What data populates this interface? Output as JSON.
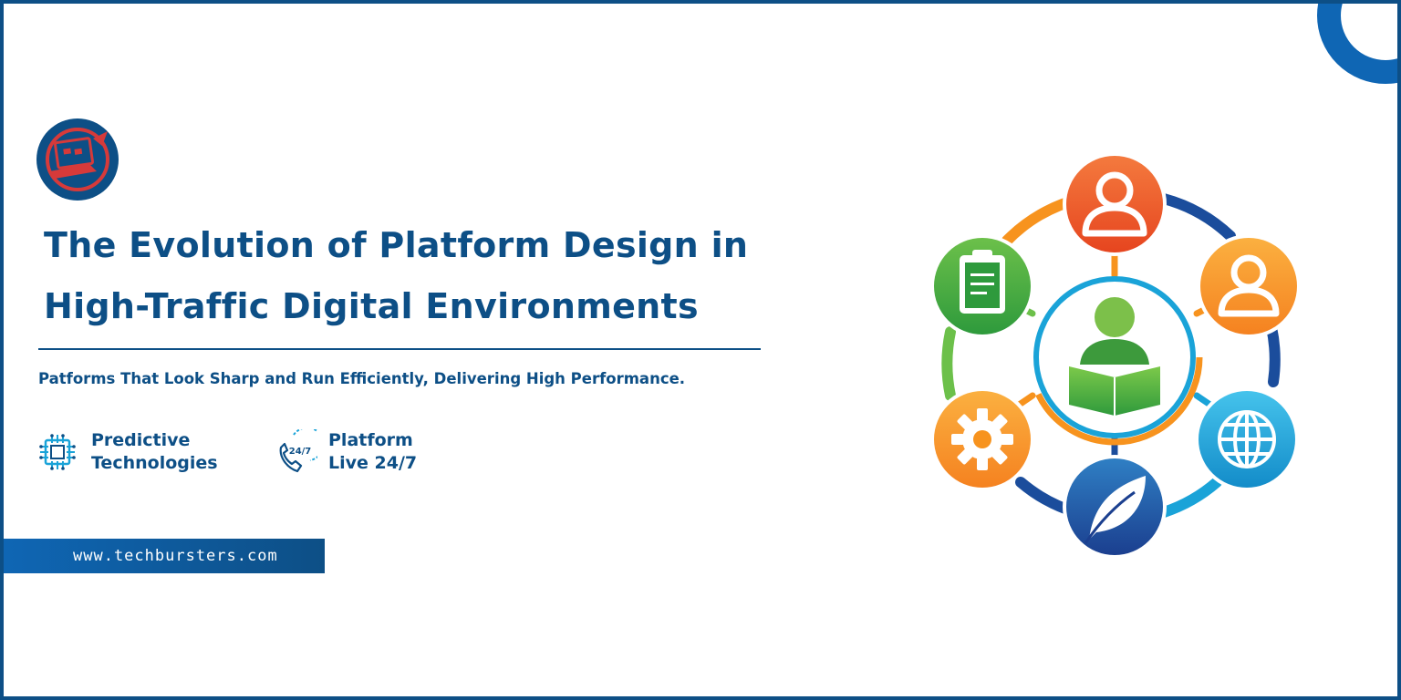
{
  "banner": {
    "title_line1": "The Evolution of Platform Design in",
    "title_line2": "High-Traffic Digital Environments",
    "subtitle": "Patforms That Look Sharp and Run Efficiently, Delivering High Performance.",
    "features": [
      {
        "icon": "chip-icon",
        "line1": "Predictive",
        "line2": "Technologies"
      },
      {
        "icon": "phone-24-7-icon",
        "line1": "Platform",
        "line2": "Live 24/7"
      }
    ],
    "website": "www.techbursters.com",
    "logo_icon": "laptop-rocket-logo",
    "badge_24_7": "24/7",
    "colors": {
      "brand_dark": "#0d4f86",
      "brand_blue": "#0f66b4",
      "logo_red": "#d63a3a"
    }
  },
  "network_illustration": {
    "center_icon": "reader-book-icon",
    "nodes": [
      {
        "icon": "user-icon",
        "color": "#f05a2a"
      },
      {
        "icon": "user-icon",
        "color": "#f7931e"
      },
      {
        "icon": "globe-icon",
        "color": "#1aa3d8"
      },
      {
        "icon": "leaf-icon",
        "color": "#1b4d9c"
      },
      {
        "icon": "gear-icon",
        "color": "#f7931e"
      },
      {
        "icon": "clipboard-icon",
        "color": "#4caf3c"
      }
    ]
  }
}
